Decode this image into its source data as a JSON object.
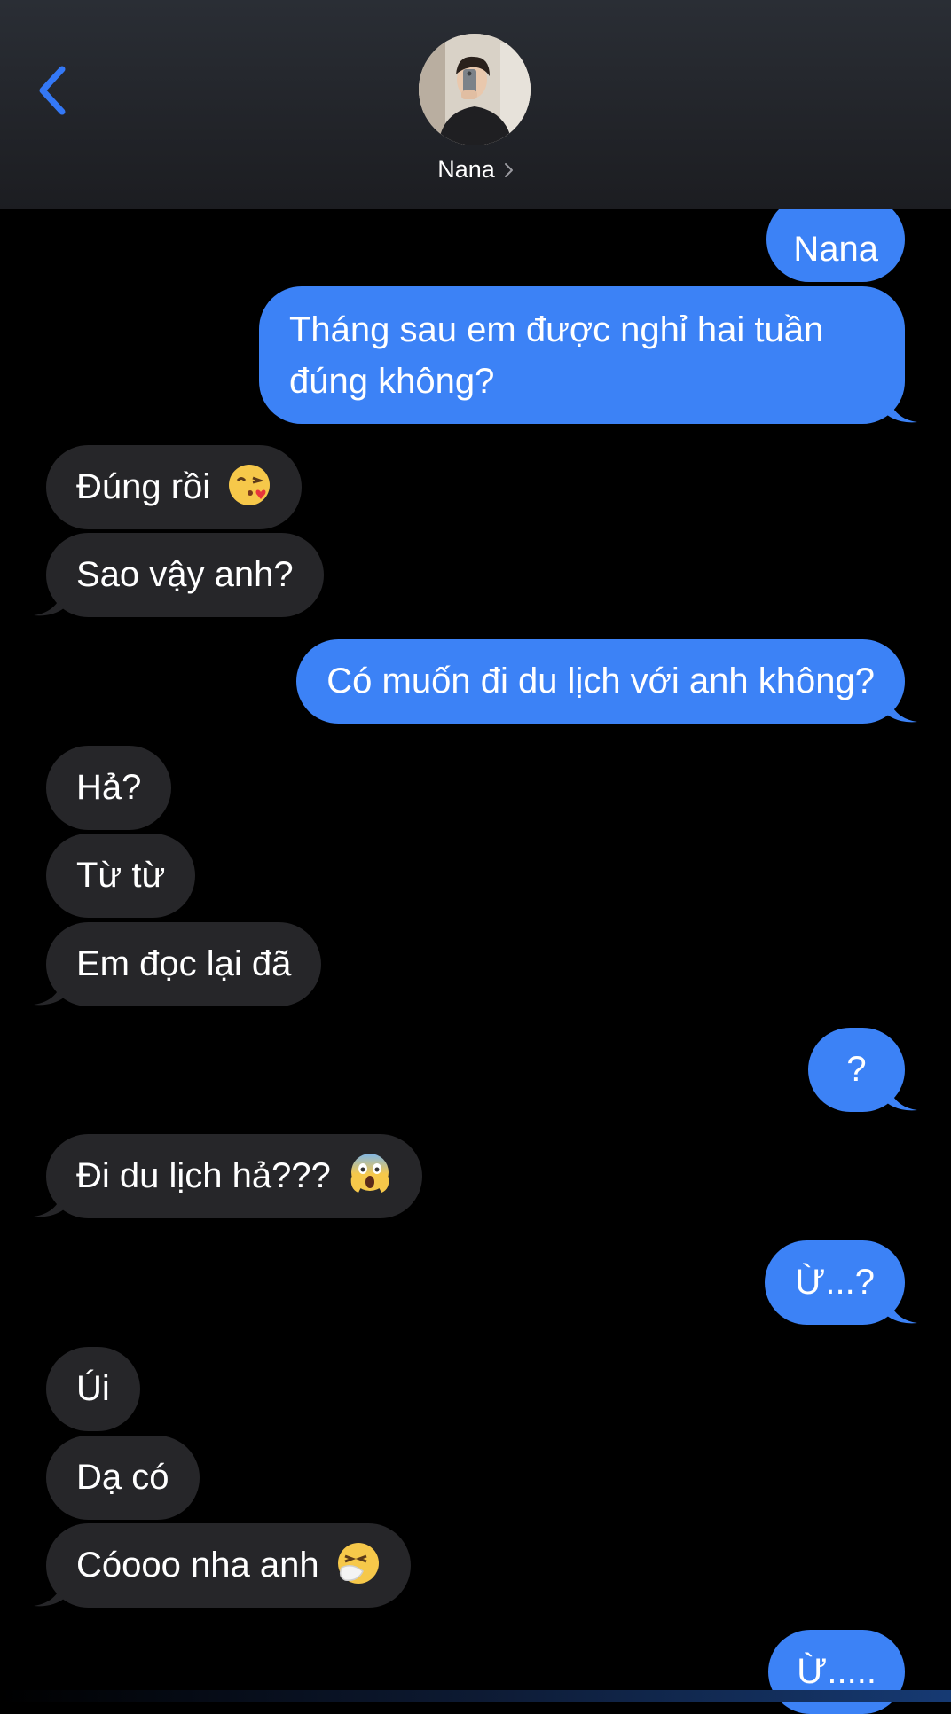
{
  "header": {
    "back_icon": "chevron-left-icon",
    "contact_name": "Nana",
    "contact_chevron_icon": "chevron-right-icon",
    "avatar_icon": "contact-avatar-photo"
  },
  "colors": {
    "outgoing_bubble": "#3c82f6",
    "incoming_bubble": "#262629",
    "back_accent": "#3478f6",
    "background": "#000000"
  },
  "messages": [
    {
      "from": "me",
      "text": "Nana"
    },
    {
      "from": "me",
      "text": "Tháng sau em được nghỉ hai tuần đúng không?"
    },
    {
      "from": "them",
      "text": "Đúng rồi",
      "emoji": "kissing-heart-emoji"
    },
    {
      "from": "them",
      "text": "Sao vậy anh?"
    },
    {
      "from": "me",
      "text": "Có muốn đi du lịch với anh không?"
    },
    {
      "from": "them",
      "text": "Hả?"
    },
    {
      "from": "them",
      "text": "Từ từ"
    },
    {
      "from": "them",
      "text": "Em đọc lại đã"
    },
    {
      "from": "me",
      "text": "?"
    },
    {
      "from": "them",
      "text": "Đi du lịch hả???",
      "emoji": "screaming-face-emoji"
    },
    {
      "from": "me",
      "text": "Ừ...?"
    },
    {
      "from": "them",
      "text": "Úi"
    },
    {
      "from": "them",
      "text": "Dạ có"
    },
    {
      "from": "them",
      "text": "Cóooo nha anh",
      "emoji": "sneezing-face-emoji"
    },
    {
      "from": "me",
      "text": "Ừ....."
    }
  ],
  "message_lines": {
    "line1": "Tháng sau em được nghỉ hai tuần",
    "line2": "đúng không?"
  }
}
